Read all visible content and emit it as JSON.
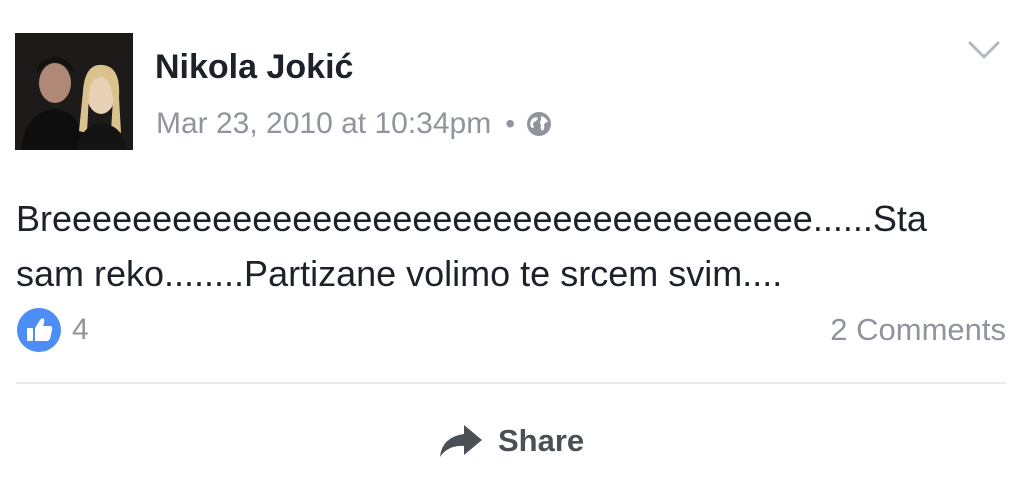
{
  "post": {
    "author": "Nikola Jokić",
    "timestamp": "Mar 23, 2010 at 10:34pm",
    "separator": "•",
    "privacy_icon": "globe-icon",
    "menu_icon": "chevron-down-icon",
    "body_lines": [
      "Breeeeeeeeeeeeeeeeeeeeeeeeeeeeeeeeeeeeee......Sta",
      "sam reko........Partizane volimo te srcem svim...."
    ],
    "like_icon": "thumbs-up-icon",
    "like_count": "4",
    "comments_label": "2 Comments",
    "share_icon": "share-arrow-icon",
    "share_label": "Share"
  },
  "colors": {
    "text_primary": "#1d2129",
    "text_secondary": "#90949c",
    "like_blue": "#4c8df6",
    "share_text": "#4b4f56",
    "divider": "#e9ebee"
  }
}
